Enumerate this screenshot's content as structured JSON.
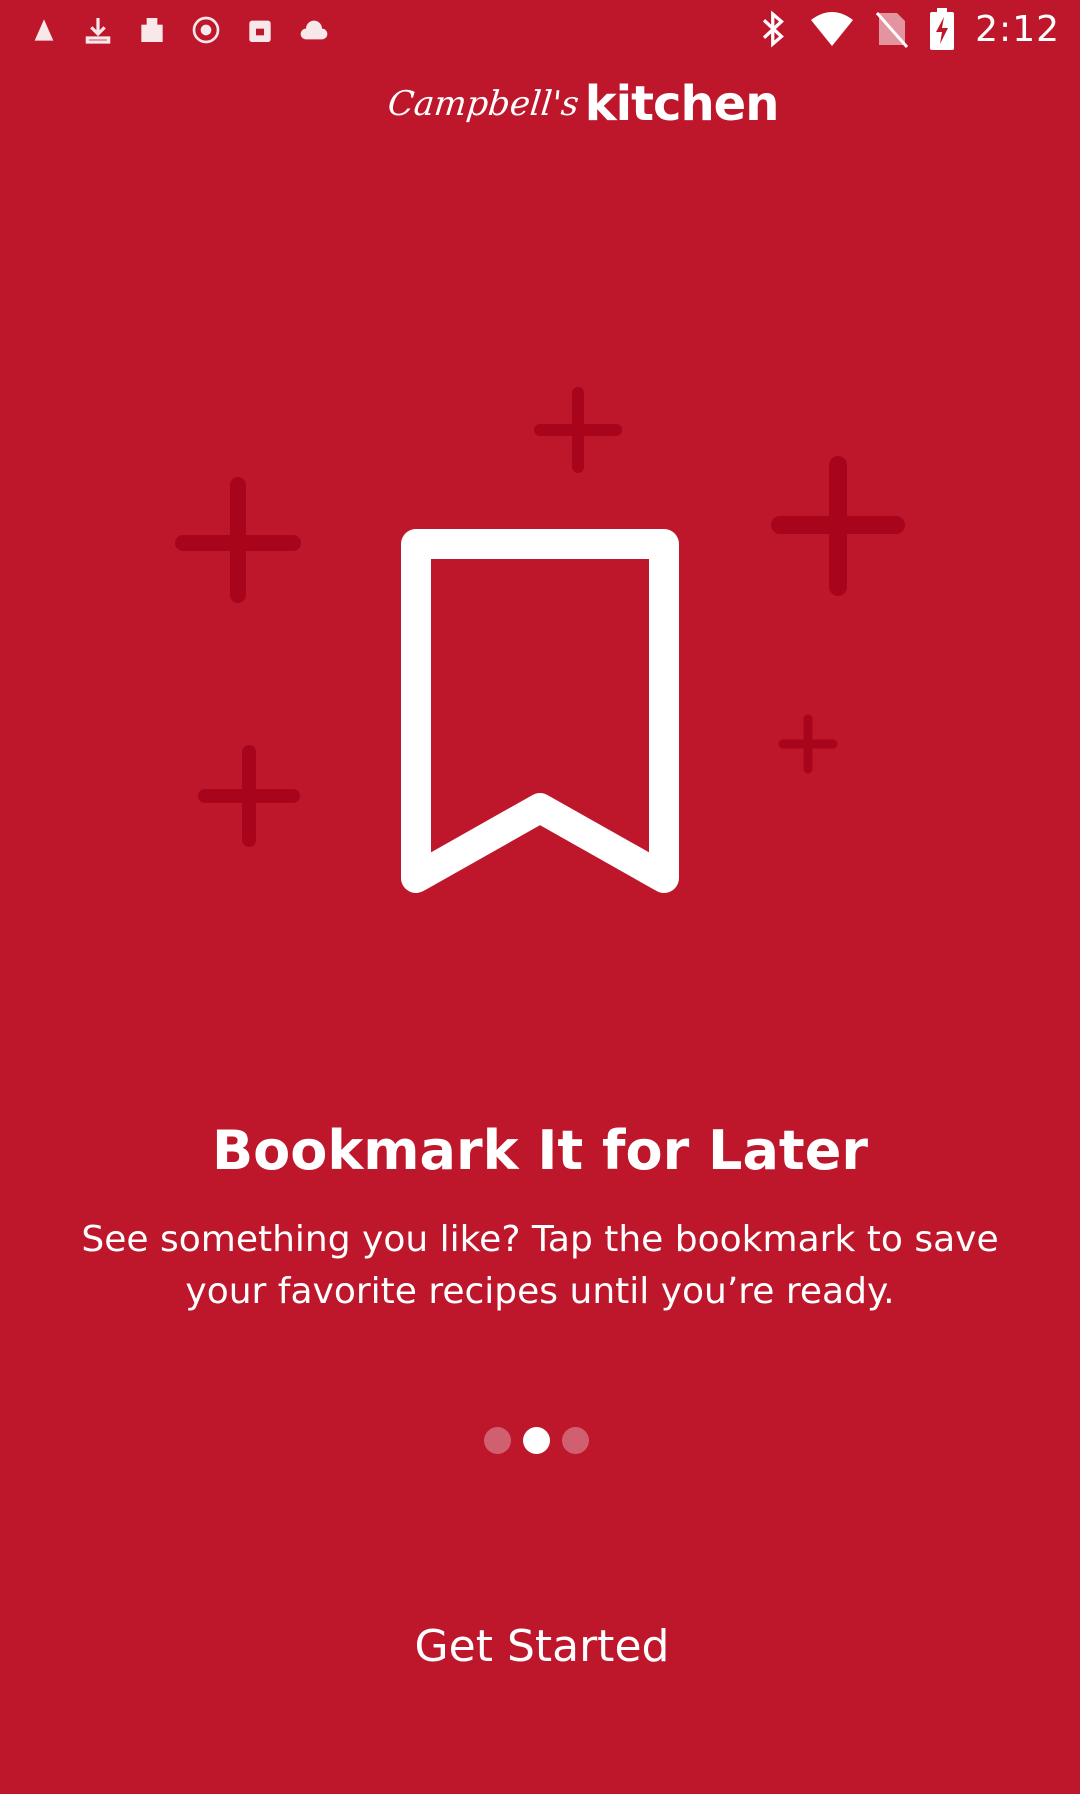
{
  "colors": {
    "background": "#BE162B",
    "foreground": "#FFFFFF",
    "decoration": "#A8051C",
    "dot_inactive": "#D06070"
  },
  "status_bar": {
    "left_icons": [
      "notification-icon",
      "download-icon",
      "app-icon",
      "record-icon",
      "calendar-icon",
      "cloud-icon"
    ],
    "right_icons": [
      "bluetooth-icon",
      "wifi-icon",
      "no-sim-icon",
      "battery-charging-icon"
    ],
    "time": "2:12"
  },
  "logo": {
    "brand": "Campbell's",
    "word": "kitchen"
  },
  "illustration": {
    "icon": "bookmark-icon",
    "decorations": "plus-icon"
  },
  "onboarding": {
    "title": "Bookmark It for Later",
    "description": "See something you like? Tap the bookmark to save your favorite recipes until you’re ready."
  },
  "pager": {
    "count": 3,
    "active_index": 1
  },
  "cta": {
    "label": "Get Started"
  }
}
